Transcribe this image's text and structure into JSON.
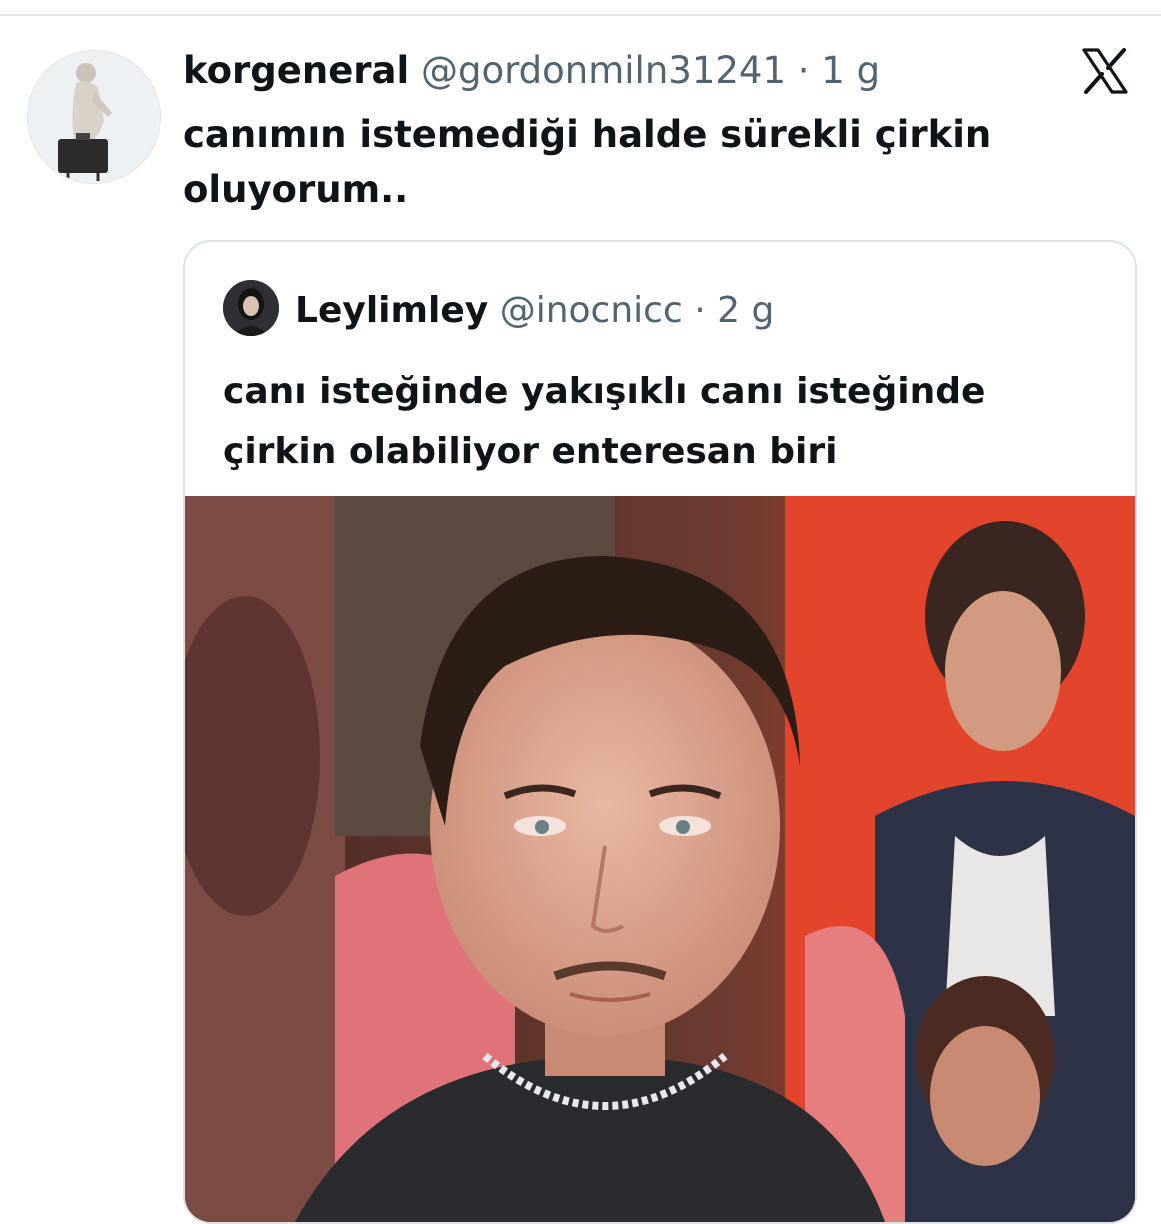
{
  "tweet": {
    "author_name": "korgeneral",
    "handle": "@gordonmiln31241",
    "separator": "·",
    "time": "1 g",
    "text_line1": "canımın istemediği halde sürekli çirkin",
    "text_line2": "oluyorum..",
    "close_icon": "x-logo-icon"
  },
  "quoted_tweet": {
    "author_name": "Leylimley",
    "handle": "@inocnicc",
    "separator": "·",
    "time": "2 g",
    "text_line1": "canı isteğinde yakışıklı canı isteğinde",
    "text_line2": "çirkin olabiliyor enteresan biri"
  },
  "colors": {
    "text_primary": "#0f1419",
    "text_secondary": "#536471",
    "border": "#dfe3e6"
  }
}
